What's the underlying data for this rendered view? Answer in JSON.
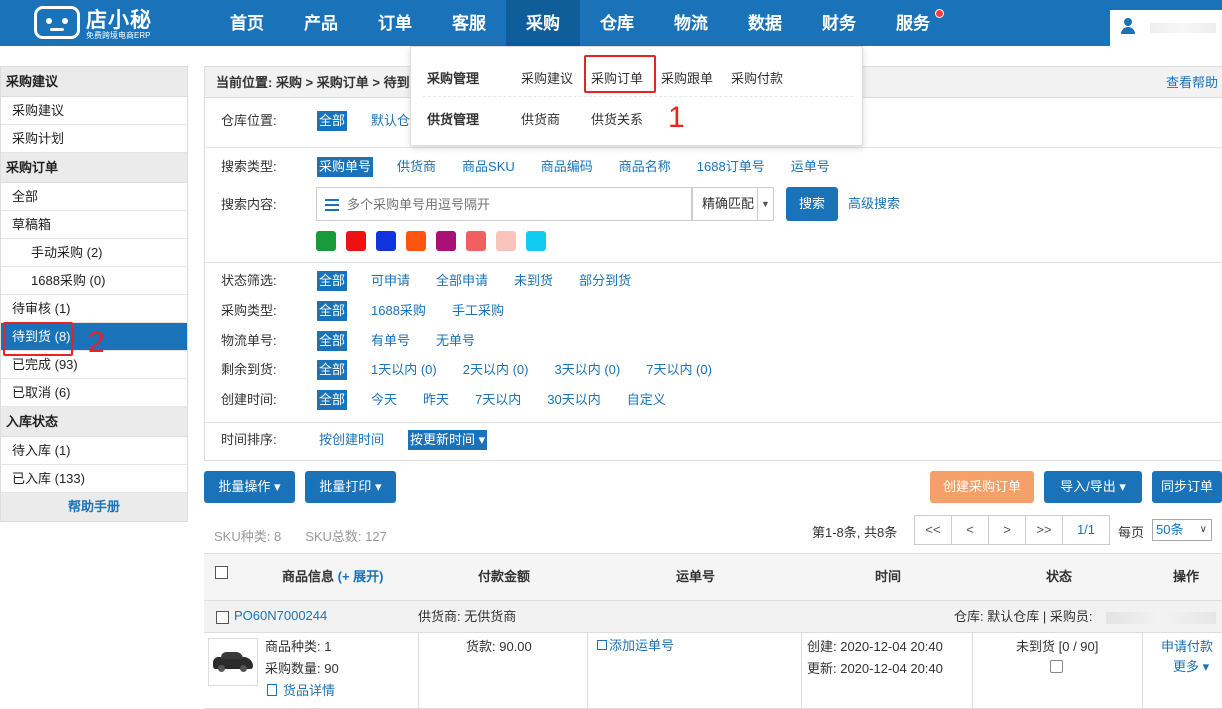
{
  "brand": {
    "name": "店小秘",
    "tagline": "免费跨境电商ERP"
  },
  "nav": {
    "items": [
      "首页",
      "产品",
      "订单",
      "客服",
      "采购",
      "仓库",
      "物流",
      "数据",
      "财务",
      "服务"
    ],
    "active": "采购"
  },
  "dropdown": {
    "group1_title": "采购管理",
    "group1_links": [
      "采购建议",
      "采购订单",
      "采购跟单",
      "采购付款"
    ],
    "group2_title": "供货管理",
    "group2_links": [
      "供货商",
      "供货关系"
    ],
    "annotation": "1"
  },
  "sidebar": {
    "section1": "采购建议",
    "s1_items": [
      "采购建议",
      "采购计划"
    ],
    "section2": "采购订单",
    "s2_items": [
      "全部",
      "草稿箱",
      "手动采购 (2)",
      "1688采购 (0)",
      "待审核 (1)",
      "待到货 (8)",
      "已完成 (93)",
      "已取消 (6)"
    ],
    "section3": "入库状态",
    "s3_items": [
      "待入库 (1)",
      "已入库 (133)"
    ],
    "help": "帮助手册",
    "annotation": "2"
  },
  "breadcrumb": "当前位置: 采购 > 采购订单 > 待到货",
  "help_link": "查看帮助",
  "filters": {
    "warehouse_label": "仓库位置:",
    "warehouse_opts": [
      "全部",
      "默认仓库"
    ],
    "search_type_label": "搜索类型:",
    "search_type_opts": [
      "采购单号",
      "供货商",
      "商品SKU",
      "商品编码",
      "商品名称",
      "1688订单号",
      "运单号"
    ],
    "search_content_label": "搜索内容:",
    "search_placeholder": "多个采购单号用逗号隔开",
    "match_mode": "精确匹配",
    "search_btn": "搜索",
    "adv_search": "高级搜索",
    "colors": [
      "#1a9a3a",
      "#ee1111",
      "#1133dd",
      "#ff5511",
      "#aa1177",
      "#f06060",
      "#f8c4bc",
      "#11ccee"
    ],
    "status_label": "状态筛选:",
    "status_opts": [
      "全部",
      "可申请",
      "全部申请",
      "未到货",
      "部分到货"
    ],
    "ptype_label": "采购类型:",
    "ptype_opts": [
      "全部",
      "1688采购",
      "手工采购"
    ],
    "tracking_label": "物流单号:",
    "tracking_opts": [
      "全部",
      "有单号",
      "无单号"
    ],
    "remain_label": "剩余到货:",
    "remain_opts": [
      "全部",
      "1天以内 (0)",
      "2天以内 (0)",
      "3天以内 (0)",
      "7天以内 (0)"
    ],
    "created_label": "创建时间:",
    "created_opts": [
      "全部",
      "今天",
      "昨天",
      "7天以内",
      "30天以内",
      "自定义"
    ],
    "sort_label": "时间排序:",
    "sort_opts": [
      "按创建时间",
      "按更新时间 ▾"
    ]
  },
  "toolbar": {
    "batch_ops": "批量操作 ▾",
    "batch_print": "批量打印 ▾",
    "create_order": "创建采购订单",
    "import_export": "导入/导出 ▾",
    "sync": "同步订单"
  },
  "stats": {
    "sku_kinds": "SKU种类: 8",
    "sku_total": "SKU总数: 127"
  },
  "pager": {
    "info": "第1-8条, 共8条",
    "buttons": [
      "<<",
      "<",
      ">",
      ">>"
    ],
    "current": "1/1",
    "per_page_label": "每页",
    "per_page": "50条"
  },
  "table": {
    "headers": [
      "商品信息",
      "(+ 展开)",
      "付款金额",
      "运单号",
      "时间",
      "状态",
      "操作"
    ]
  },
  "order": {
    "po": "PO60N7000244",
    "supplier": "供货商: 无供货商",
    "warehouse": "仓库: 默认仓库 | 采购员:",
    "kinds": "商品种类: 1",
    "qty": "采购数量: 90",
    "details": "货品详情",
    "amount": "货款: 90.00",
    "add_tracking": "添加运单号",
    "created": "创建: 2020-12-04 20:40",
    "updated": "更新: 2020-12-04 20:40",
    "status": "未到货 [0 / 90]",
    "apply_pay": "申请付款",
    "more": "更多 ▾"
  }
}
